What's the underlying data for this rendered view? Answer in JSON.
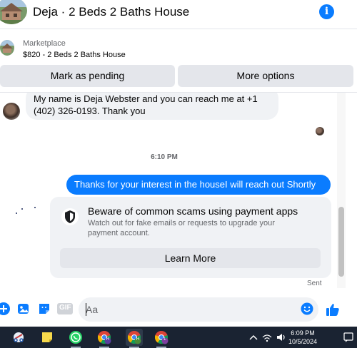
{
  "header": {
    "title": "Deja · 2 Beds 2 Baths House",
    "info_icon": "info-icon",
    "info_glyph": "i"
  },
  "listing": {
    "label": "Marketplace",
    "detail": "$820 - 2 Beds 2 Baths House"
  },
  "actions": {
    "mark_pending": "Mark as pending",
    "more_options": "More options"
  },
  "messages": {
    "incoming_text": "My name is Deja Webster and you can reach me at +1 (402) 326-0193. Thank you",
    "timestamp": "6:10 PM",
    "outgoing_text": "Thanks for your interest in the houseI will reach out Shortly",
    "status": "Sent"
  },
  "scam_notice": {
    "title": "Beware of common scams using payment apps",
    "description": "Watch out for fake emails or requests to upgrade your payment account.",
    "button": "Learn More"
  },
  "composer": {
    "placeholder": "Aa",
    "gif_label": "GIF"
  },
  "taskbar": {
    "time": "6:09 PM",
    "date": "10/5/2024",
    "profile_badges": [
      "R",
      "H",
      "L"
    ]
  },
  "colors": {
    "accent": "#0a7cff",
    "bubble_gray": "#f0f2f5",
    "taskbar": "#1a2332"
  }
}
